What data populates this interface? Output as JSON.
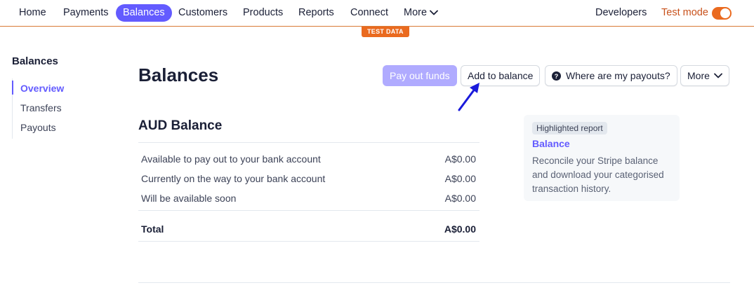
{
  "topnav": {
    "items": [
      {
        "label": "Home"
      },
      {
        "label": "Payments"
      },
      {
        "label": "Balances",
        "active": true
      },
      {
        "label": "Customers"
      },
      {
        "label": "Products"
      },
      {
        "label": "Reports"
      },
      {
        "label": "Connect"
      },
      {
        "label": "More"
      }
    ],
    "developers": "Developers",
    "test_mode": "Test mode",
    "test_mode_on": true
  },
  "test_data_badge": "TEST DATA",
  "sidebar": {
    "title": "Balances",
    "items": [
      {
        "label": "Overview",
        "active": true
      },
      {
        "label": "Transfers"
      },
      {
        "label": "Payouts"
      }
    ]
  },
  "header": {
    "title": "Balances",
    "buttons": {
      "pay_out": "Pay out funds",
      "add_balance": "Add to balance",
      "payouts_help": "Where are my payouts?",
      "more": "More"
    }
  },
  "balance": {
    "title": "AUD Balance",
    "rows": [
      {
        "label": "Available to pay out to your bank account",
        "value": "A$0.00"
      },
      {
        "label": "Currently on the way to your bank account",
        "value": "A$0.00"
      },
      {
        "label": "Will be available soon",
        "value": "A$0.00"
      }
    ],
    "total": {
      "label": "Total",
      "value": "A$0.00"
    }
  },
  "report_card": {
    "badge": "Highlighted report",
    "link": "Balance",
    "description": "Reconcile your Stripe balance and download your categorised transaction history."
  },
  "colors": {
    "accent": "#635bff",
    "test_mode": "#ea6a1f",
    "annotation_arrow": "#1a1adb"
  }
}
